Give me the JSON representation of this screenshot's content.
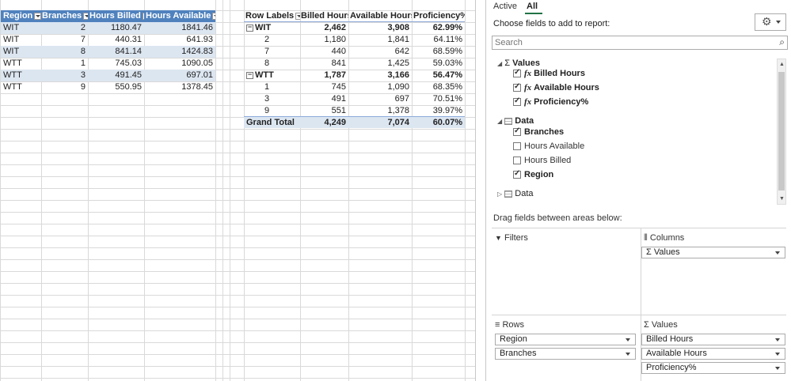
{
  "source_table": {
    "headers": [
      "Region",
      "Branches",
      "Hours Billed",
      "Hours Available"
    ],
    "rows": [
      [
        "WIT",
        "2",
        "1180.47",
        "1841.46"
      ],
      [
        "WIT",
        "7",
        "440.31",
        "641.93"
      ],
      [
        "WIT",
        "8",
        "841.14",
        "1424.83"
      ],
      [
        "WTT",
        "1",
        "745.03",
        "1090.05"
      ],
      [
        "WTT",
        "3",
        "491.45",
        "697.01"
      ],
      [
        "WTT",
        "9",
        "550.95",
        "1378.45"
      ]
    ]
  },
  "pivot": {
    "headers": [
      "Row Labels",
      "Billed Hours",
      "Available Hours",
      "Proficiency%"
    ],
    "rows": [
      {
        "label": "WIT",
        "billed": "2,462",
        "available": "3,908",
        "prof": "62.99%",
        "group": true
      },
      {
        "label": "2",
        "billed": "1,180",
        "available": "1,841",
        "prof": "64.11%",
        "group": false
      },
      {
        "label": "7",
        "billed": "440",
        "available": "642",
        "prof": "68.59%",
        "group": false
      },
      {
        "label": "8",
        "billed": "841",
        "available": "1,425",
        "prof": "59.03%",
        "group": false
      },
      {
        "label": "WTT",
        "billed": "1,787",
        "available": "3,166",
        "prof": "56.47%",
        "group": true
      },
      {
        "label": "1",
        "billed": "745",
        "available": "1,090",
        "prof": "68.35%",
        "group": false
      },
      {
        "label": "3",
        "billed": "491",
        "available": "697",
        "prof": "70.51%",
        "group": false
      },
      {
        "label": "9",
        "billed": "551",
        "available": "1,378",
        "prof": "39.97%",
        "group": false
      }
    ],
    "total": {
      "label": "Grand Total",
      "billed": "4,249",
      "available": "7,074",
      "prof": "60.07%"
    },
    "minus_glyph": "−"
  },
  "field_list": {
    "tab_active": "Active",
    "tab_all": "All",
    "choose_label": "Choose fields to add to report:",
    "search_placeholder": "Search",
    "values_group": "Values",
    "values_fields": [
      "Billed Hours",
      "Available Hours",
      "Proficiency%"
    ],
    "data_group": "Data",
    "data_fields": [
      {
        "name": "Branches",
        "checked": true
      },
      {
        "name": "Hours Available",
        "checked": false
      },
      {
        "name": "Hours Billed",
        "checked": false
      },
      {
        "name": "Region",
        "checked": true
      }
    ],
    "data_group2": "Data",
    "sigma": "Σ",
    "fx": "fx",
    "drag_label": "Drag fields between areas below:",
    "filters_label": "Filters",
    "columns_label": "Columns",
    "columns_items": [
      "Σ Values"
    ],
    "rows_label": "Rows",
    "rows_items": [
      "Region",
      "Branches"
    ],
    "values_label": "Values",
    "values_items": [
      "Billed Hours",
      "Available Hours",
      "Proficiency%"
    ]
  },
  "colors": {
    "header_blue": "#4f81bd",
    "band_blue": "#dce6f1"
  }
}
